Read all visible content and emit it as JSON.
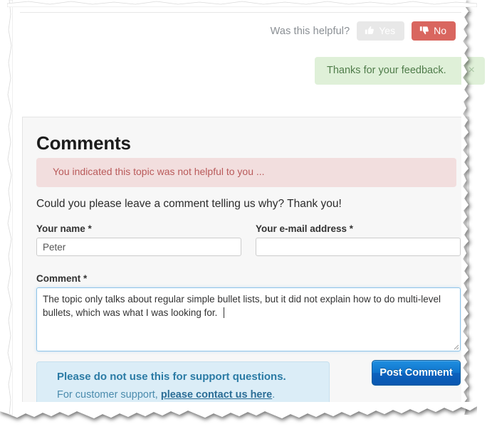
{
  "feedback": {
    "question": "Was this helpful?",
    "yes_label": "Yes",
    "no_label": "No",
    "thanks_message": "Thanks for your feedback.",
    "close_glyph": "×"
  },
  "comments": {
    "heading": "Comments",
    "not_helpful_notice": "You indicated this topic was not helpful to you ...",
    "prompt": "Could you please leave a comment telling us why? Thank you!",
    "fields": {
      "name_label": "Your name *",
      "name_value": "Peter",
      "name_placeholder": "",
      "email_label": "Your e-mail address *",
      "email_value": "",
      "email_placeholder": "",
      "comment_label": "Comment *",
      "comment_value": "The topic only talks about regular simple bullet lists, but it did not explain how to do multi-level bullets, which was what I was looking for. ",
      "comment_placeholder": ""
    },
    "support_note": {
      "title": "Please do not use this for support questions.",
      "body_prefix": "For customer support, ",
      "link_text": "please contact us here",
      "body_suffix": "."
    },
    "submit_label": "Post Comment"
  },
  "colors": {
    "no_button": "#d9665f",
    "yes_button": "#e8e8e8",
    "thanks_bg": "#dff0d8",
    "thanks_text": "#4f7c4a",
    "warning_bg": "#f2dede",
    "warning_text": "#b95a5a",
    "info_bg": "#dbedf7",
    "info_text": "#2b7ba5",
    "panel_bg": "#f7f7f7",
    "submit_blue": "#0f74cc",
    "focus_border": "#8ec4e8"
  }
}
